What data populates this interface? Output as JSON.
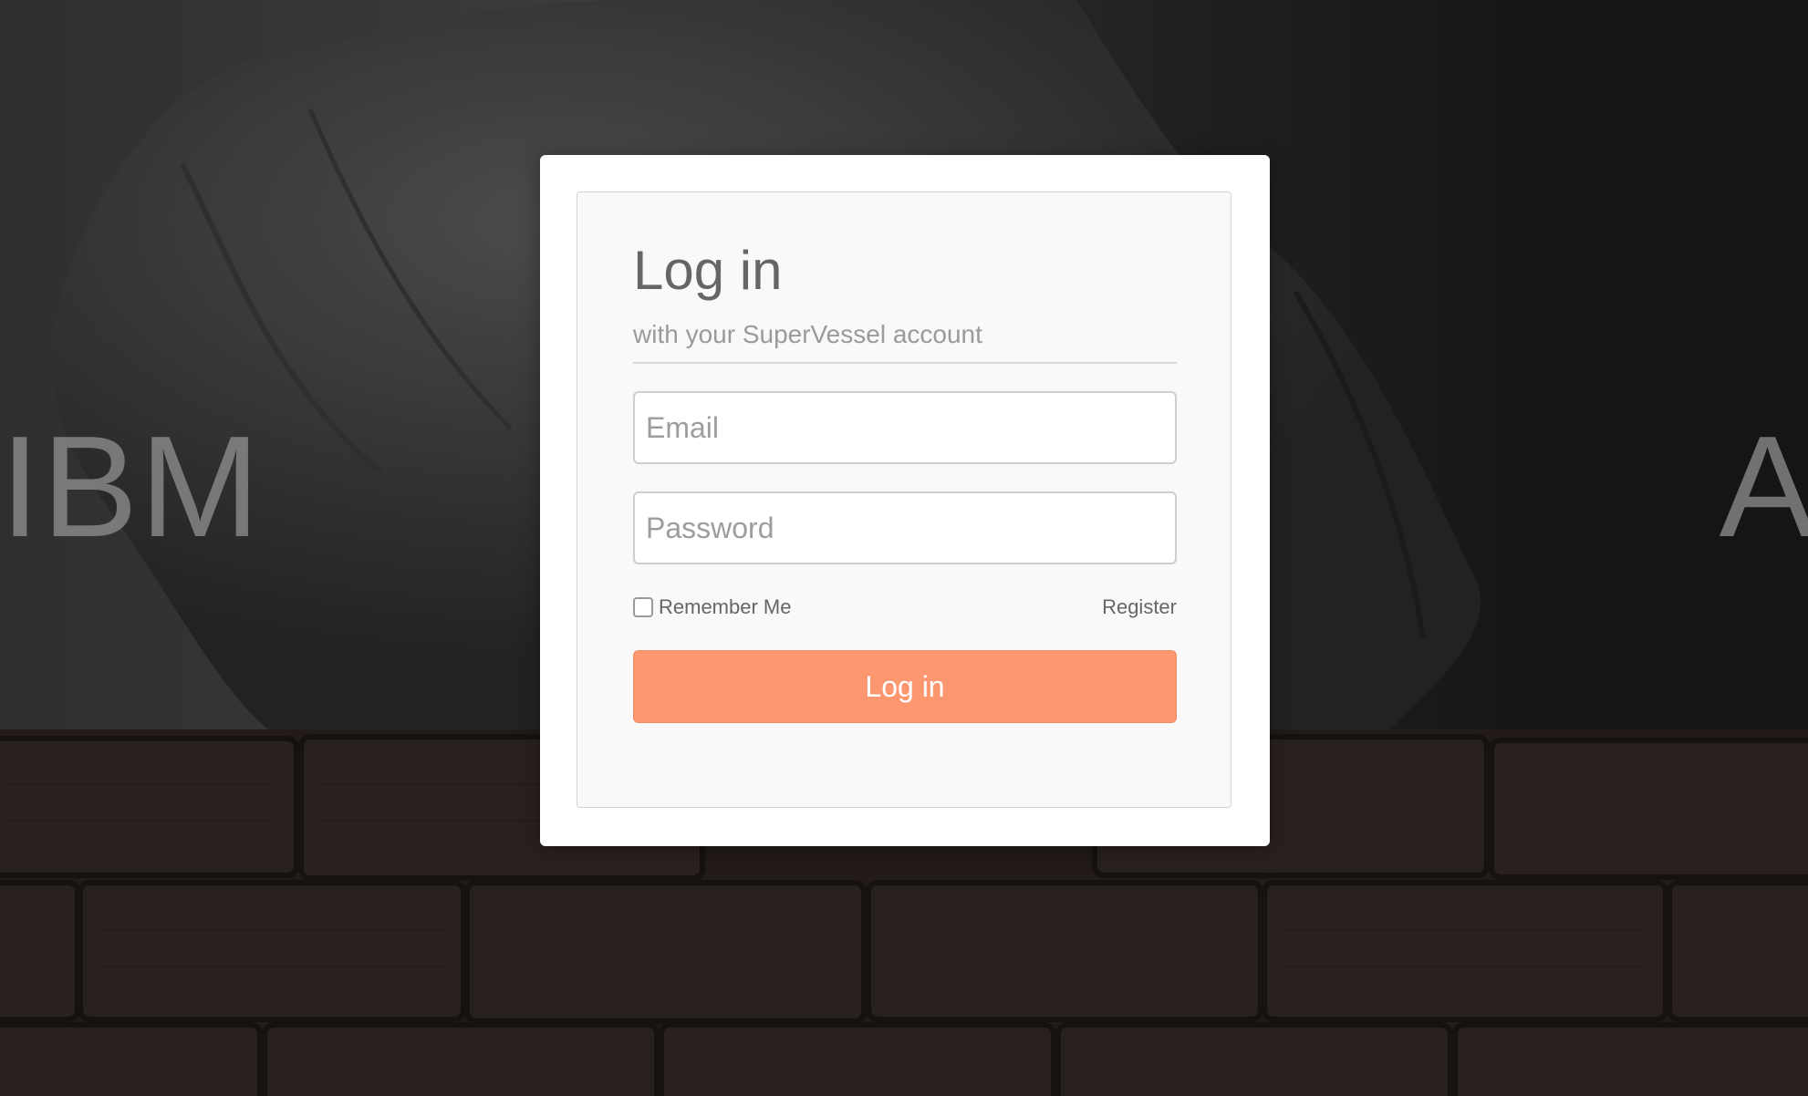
{
  "background": {
    "hero_text": "IBM                                   AIN"
  },
  "login": {
    "title": "Log in",
    "subtitle": "with your SuperVessel account",
    "email_placeholder": "Email",
    "email_value": "",
    "password_placeholder": "Password",
    "password_value": "",
    "remember_label": "Remember Me",
    "remember_checked": false,
    "register_label": "Register",
    "submit_label": "Log in"
  },
  "colors": {
    "accent": "#fc9770",
    "modal_bg": "#ffffff",
    "panel_bg": "#f9f9f9",
    "text_muted": "#666666"
  }
}
